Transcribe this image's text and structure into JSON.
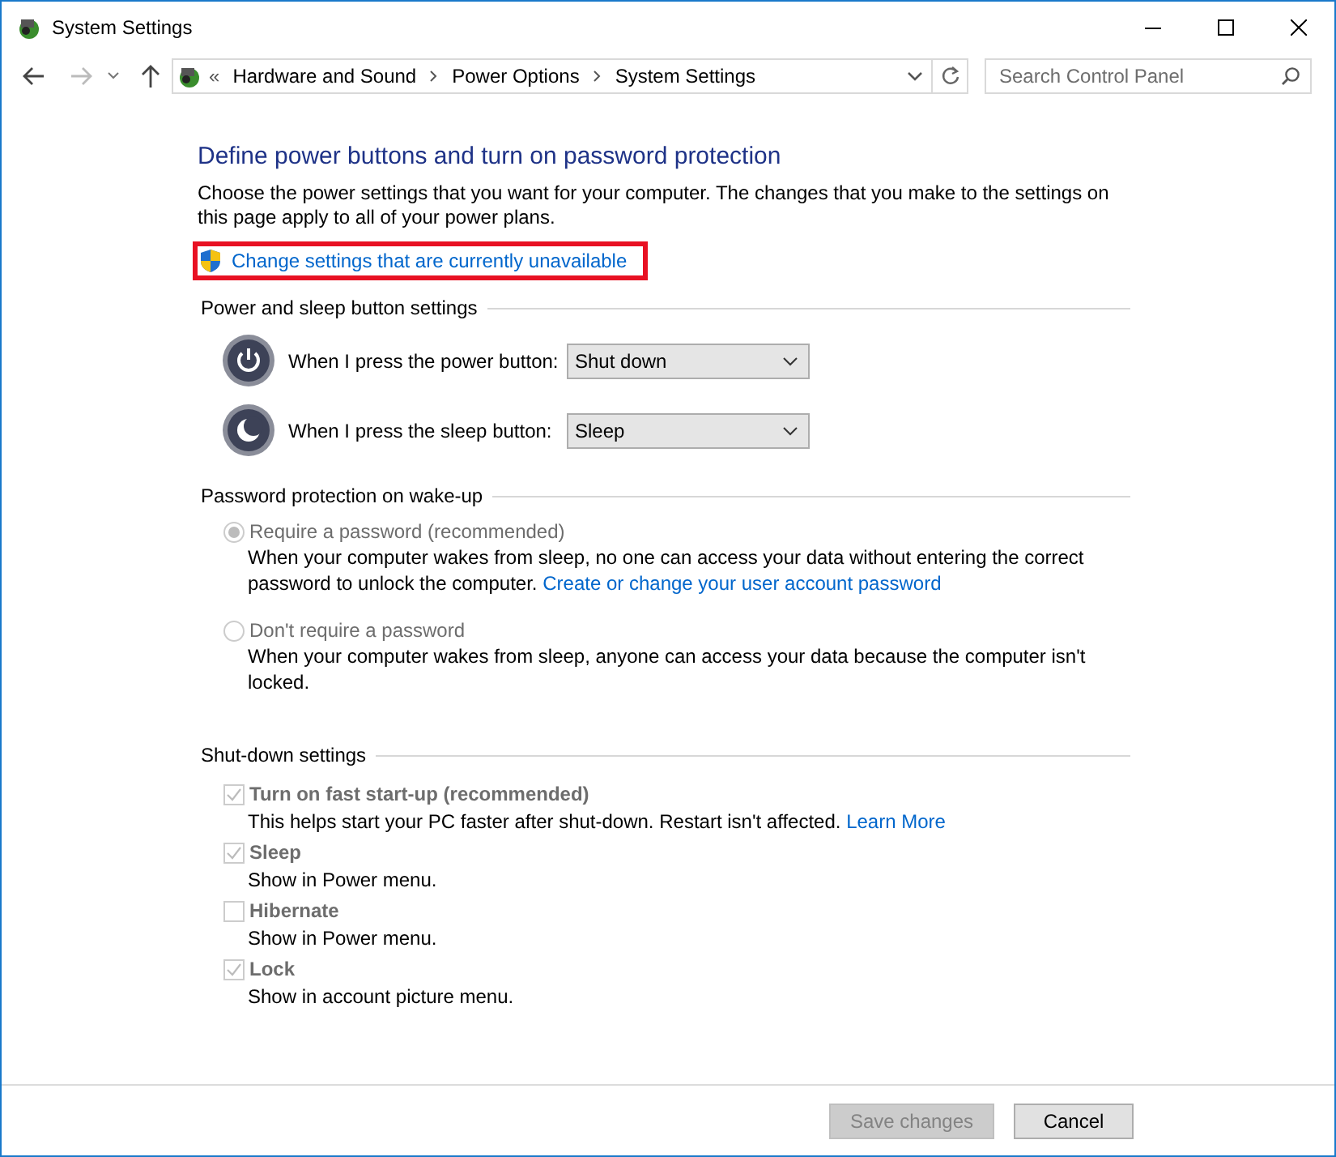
{
  "window": {
    "title": "System Settings"
  },
  "address_bar": {
    "overflow_mark": "«",
    "breadcrumb": [
      "Hardware and Sound",
      "Power Options",
      "System Settings"
    ]
  },
  "search": {
    "placeholder": "Search Control Panel"
  },
  "heading": "Define power buttons and turn on password protection",
  "intro": "Choose the power settings that you want for your computer. The changes that you make to the settings on this page apply to all of your power plans.",
  "admin_link": {
    "label": "Change settings that are currently unavailable",
    "highlighted": true
  },
  "power_buttons": {
    "title": "Power and sleep button settings",
    "rows": [
      {
        "kind": "power",
        "label": "When I press the power button:",
        "value": "Shut down"
      },
      {
        "kind": "sleep",
        "label": "When I press the sleep button:",
        "value": "Sleep"
      }
    ]
  },
  "password": {
    "title": "Password protection on wake-up",
    "options": [
      {
        "label": "Require a password (recommended)",
        "selected": true,
        "disabled": true,
        "description": "When your computer wakes from sleep, no one can access your data without entering the correct password to unlock the computer.",
        "link": "Create or change your user account password"
      },
      {
        "label": "Don't require a password",
        "selected": false,
        "disabled": true,
        "description": "When your computer wakes from sleep, anyone can access your data because the computer isn't locked."
      }
    ]
  },
  "shutdown": {
    "title": "Shut-down settings",
    "items": [
      {
        "label": "Turn on fast start-up (recommended)",
        "checked": true,
        "disabled": true,
        "description": "This helps start your PC faster after shut-down. Restart isn't affected.",
        "link": "Learn More"
      },
      {
        "label": "Sleep",
        "checked": true,
        "disabled": true,
        "description": "Show in Power menu."
      },
      {
        "label": "Hibernate",
        "checked": false,
        "disabled": true,
        "description": "Show in Power menu."
      },
      {
        "label": "Lock",
        "checked": true,
        "disabled": true,
        "description": "Show in account picture menu."
      }
    ]
  },
  "buttons": [
    {
      "label": "Save changes",
      "disabled": true
    },
    {
      "label": "Cancel",
      "disabled": false
    }
  ]
}
